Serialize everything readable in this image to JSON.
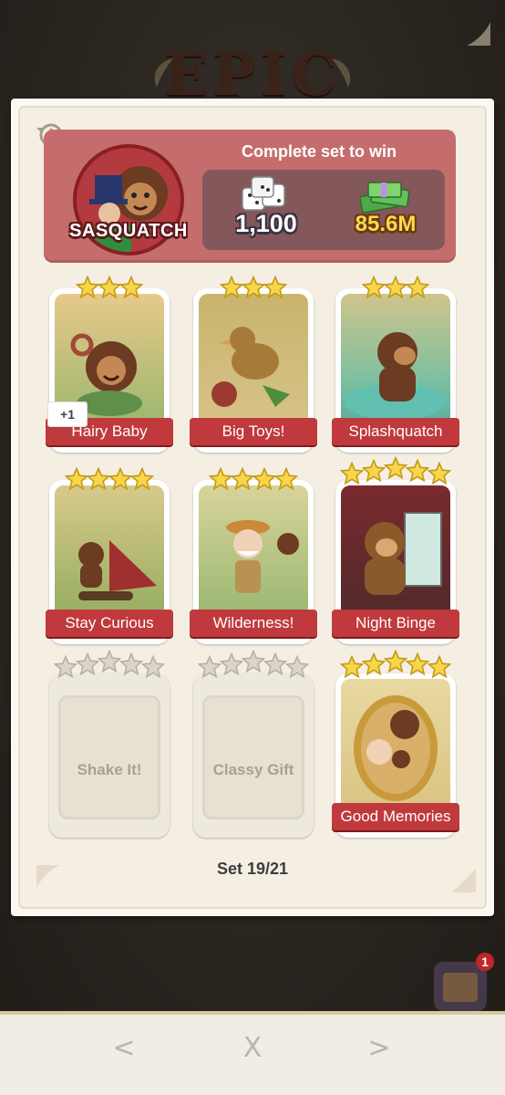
{
  "banner": {
    "title": "EPIC"
  },
  "header": {
    "set_name": "SASQUATCH",
    "complete_text": "Complete set to win",
    "rewards": {
      "dice": "1,100",
      "cash": "85.6M"
    }
  },
  "cards": [
    {
      "name": "Hairy Baby",
      "stars": 3,
      "owned": true,
      "extra_badge": "+1"
    },
    {
      "name": "Big Toys!",
      "stars": 3,
      "owned": true
    },
    {
      "name": "Splashquatch",
      "stars": 3,
      "owned": true
    },
    {
      "name": "Stay Curious",
      "stars": 4,
      "owned": true
    },
    {
      "name": "Wilderness!",
      "stars": 4,
      "owned": true
    },
    {
      "name": "Night Binge",
      "stars": 5,
      "owned": true
    },
    {
      "name": "Shake It!",
      "stars": 5,
      "owned": false
    },
    {
      "name": "Classy Gift",
      "stars": 5,
      "owned": false
    },
    {
      "name": "Good Memories",
      "stars": 5,
      "owned": true
    }
  ],
  "footer": {
    "set_count": "Set 19/21"
  },
  "side_widget": {
    "badge": "1"
  },
  "nav": {
    "prev": "<",
    "close": "X",
    "next": ">"
  },
  "colors": {
    "header": "#c56d6c",
    "label": "#c0393d",
    "star": "#f7d64a",
    "star_empty": "#dad5c9"
  }
}
